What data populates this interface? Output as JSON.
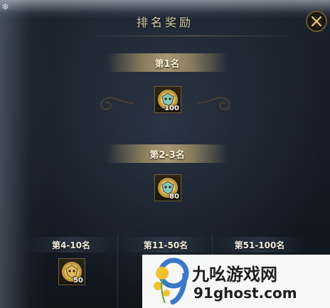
{
  "dialog": {
    "title": "排名奖励",
    "close_icon": "close-x-icon"
  },
  "tiers": [
    {
      "label": "第1名",
      "reward_icon": "mask-token-icon",
      "reward_count": "100"
    },
    {
      "label": "第2-3名",
      "reward_icon": "mask-token-icon",
      "reward_count": "80"
    },
    {
      "label": "第4-10名",
      "reward_icon": "mask-token-icon",
      "reward_count": "50"
    },
    {
      "label": "第11-50名"
    },
    {
      "label": "第51-100名"
    }
  ],
  "watermark": {
    "name": "九吆游戏网",
    "url": "91ghost.com"
  },
  "colors": {
    "gold_text": "#d8c9a4",
    "banner_gold": "#b49a69",
    "frame_gold": "#6e5d3a"
  }
}
